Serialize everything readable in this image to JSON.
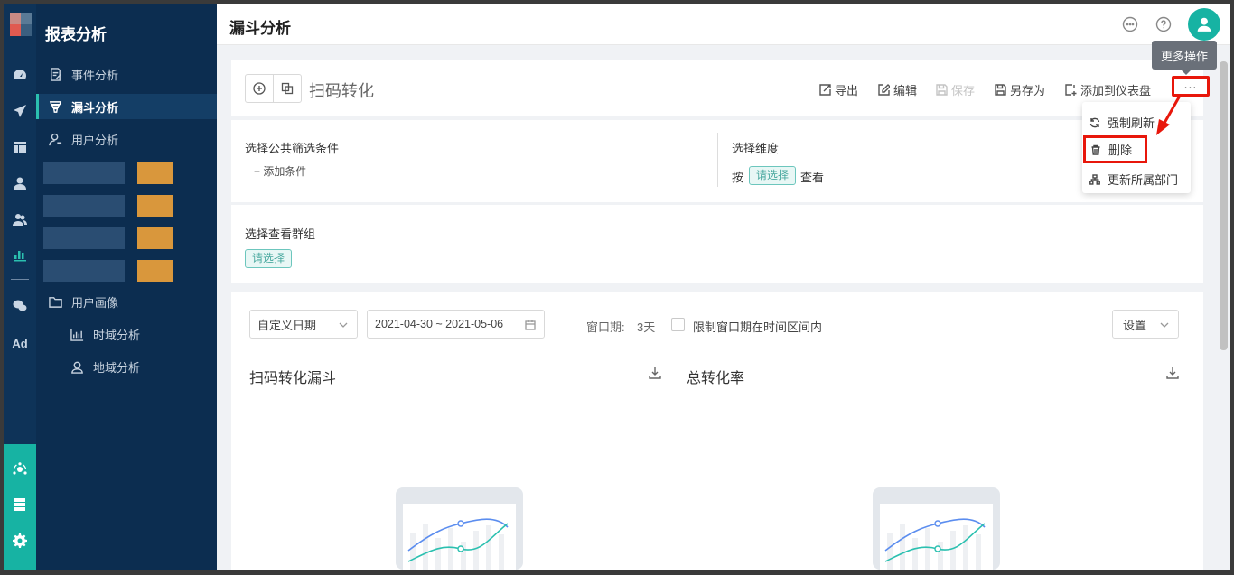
{
  "app": {
    "section_title": "报表分析",
    "page_title": "漏斗分析"
  },
  "rail": {
    "items": [
      "dashboard-icon",
      "send-icon",
      "layout-icon",
      "user-icon",
      "users-icon",
      "bar-chart-icon",
      "wechat-icon",
      "ad-icon",
      "analytics-icon",
      "server-icon",
      "gear-icon"
    ],
    "ad_label": "Ad",
    "accent": "#2bc0b0",
    "bottom_color": "#17b3a3"
  },
  "menu": {
    "items": [
      {
        "label": "事件分析",
        "icon": "edit-doc-icon"
      },
      {
        "label": "漏斗分析",
        "icon": "funnel-icon",
        "active": true
      },
      {
        "label": "用户分析",
        "icon": "user-outline-icon"
      },
      {
        "label": "用户画像",
        "icon": "folder-icon"
      },
      {
        "label": "时域分析",
        "icon": "chart-icon"
      },
      {
        "label": "地域分析",
        "icon": "location-user-icon"
      }
    ]
  },
  "toolbar": {
    "report_name": "扫码转化",
    "export": "导出",
    "edit": "编辑",
    "save": "保存",
    "save_as": "另存为",
    "add_dashboard": "添加到仪表盘",
    "more": "...",
    "more_tooltip": "更多操作"
  },
  "dropdown": {
    "refresh": "强制刷新",
    "delete": "删除",
    "update_dept": "更新所属部门"
  },
  "filters": {
    "common_label": "选择公共筛选条件",
    "add_condition": "添加条件",
    "dimension_label": "选择维度",
    "by": "按",
    "select_placeholder": "请选择",
    "view": "查看"
  },
  "group": {
    "label": "选择查看群组",
    "select_placeholder": "请选择"
  },
  "main": {
    "date_mode": "自定义日期",
    "date_range": "2021-04-30 ~ 2021-05-06",
    "window_label": "窗口期:",
    "window_value": "3天",
    "limit_label": "限制窗口期在时间区间内",
    "settings": "设置",
    "funnel_title": "扫码转化漏斗",
    "rate_title": "总转化率"
  }
}
